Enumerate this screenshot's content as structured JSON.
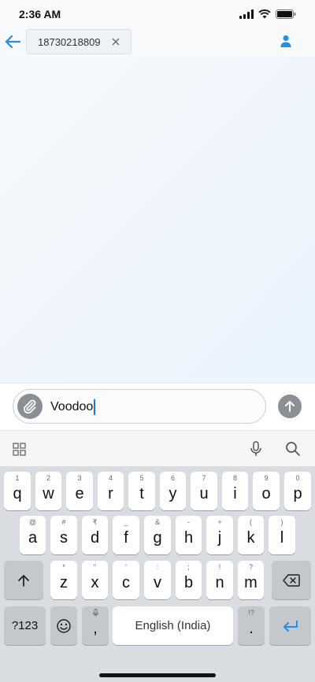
{
  "status_bar": {
    "time": "2:36 AM"
  },
  "header": {
    "recipient": "18730218809"
  },
  "compose": {
    "text": "Voodoo"
  },
  "keyboard": {
    "row1": [
      {
        "hint": "1",
        "key": "q"
      },
      {
        "hint": "2",
        "key": "w"
      },
      {
        "hint": "3",
        "key": "e"
      },
      {
        "hint": "4",
        "key": "r"
      },
      {
        "hint": "5",
        "key": "t"
      },
      {
        "hint": "6",
        "key": "y"
      },
      {
        "hint": "7",
        "key": "u"
      },
      {
        "hint": "8",
        "key": "i"
      },
      {
        "hint": "9",
        "key": "o"
      },
      {
        "hint": "0",
        "key": "p"
      }
    ],
    "row2": [
      {
        "hint": "@",
        "key": "a"
      },
      {
        "hint": "#",
        "key": "s"
      },
      {
        "hint": "₹",
        "key": "d"
      },
      {
        "hint": "_",
        "key": "f"
      },
      {
        "hint": "&",
        "key": "g"
      },
      {
        "hint": "-",
        "key": "h"
      },
      {
        "hint": "+",
        "key": "j"
      },
      {
        "hint": "(",
        "key": "k"
      },
      {
        "hint": ")",
        "key": "l"
      }
    ],
    "row3": [
      {
        "hint": "*",
        "key": "z"
      },
      {
        "hint": "\"",
        "key": "x"
      },
      {
        "hint": "'",
        "key": "c"
      },
      {
        "hint": ":",
        "key": "v"
      },
      {
        "hint": ";",
        "key": "b"
      },
      {
        "hint": "!",
        "key": "n"
      },
      {
        "hint": "?",
        "key": "m"
      }
    ],
    "symbols_label": "?123",
    "comma_key": ",",
    "space_label": "English (India)",
    "period_key": ".",
    "period_hint": "!?"
  }
}
